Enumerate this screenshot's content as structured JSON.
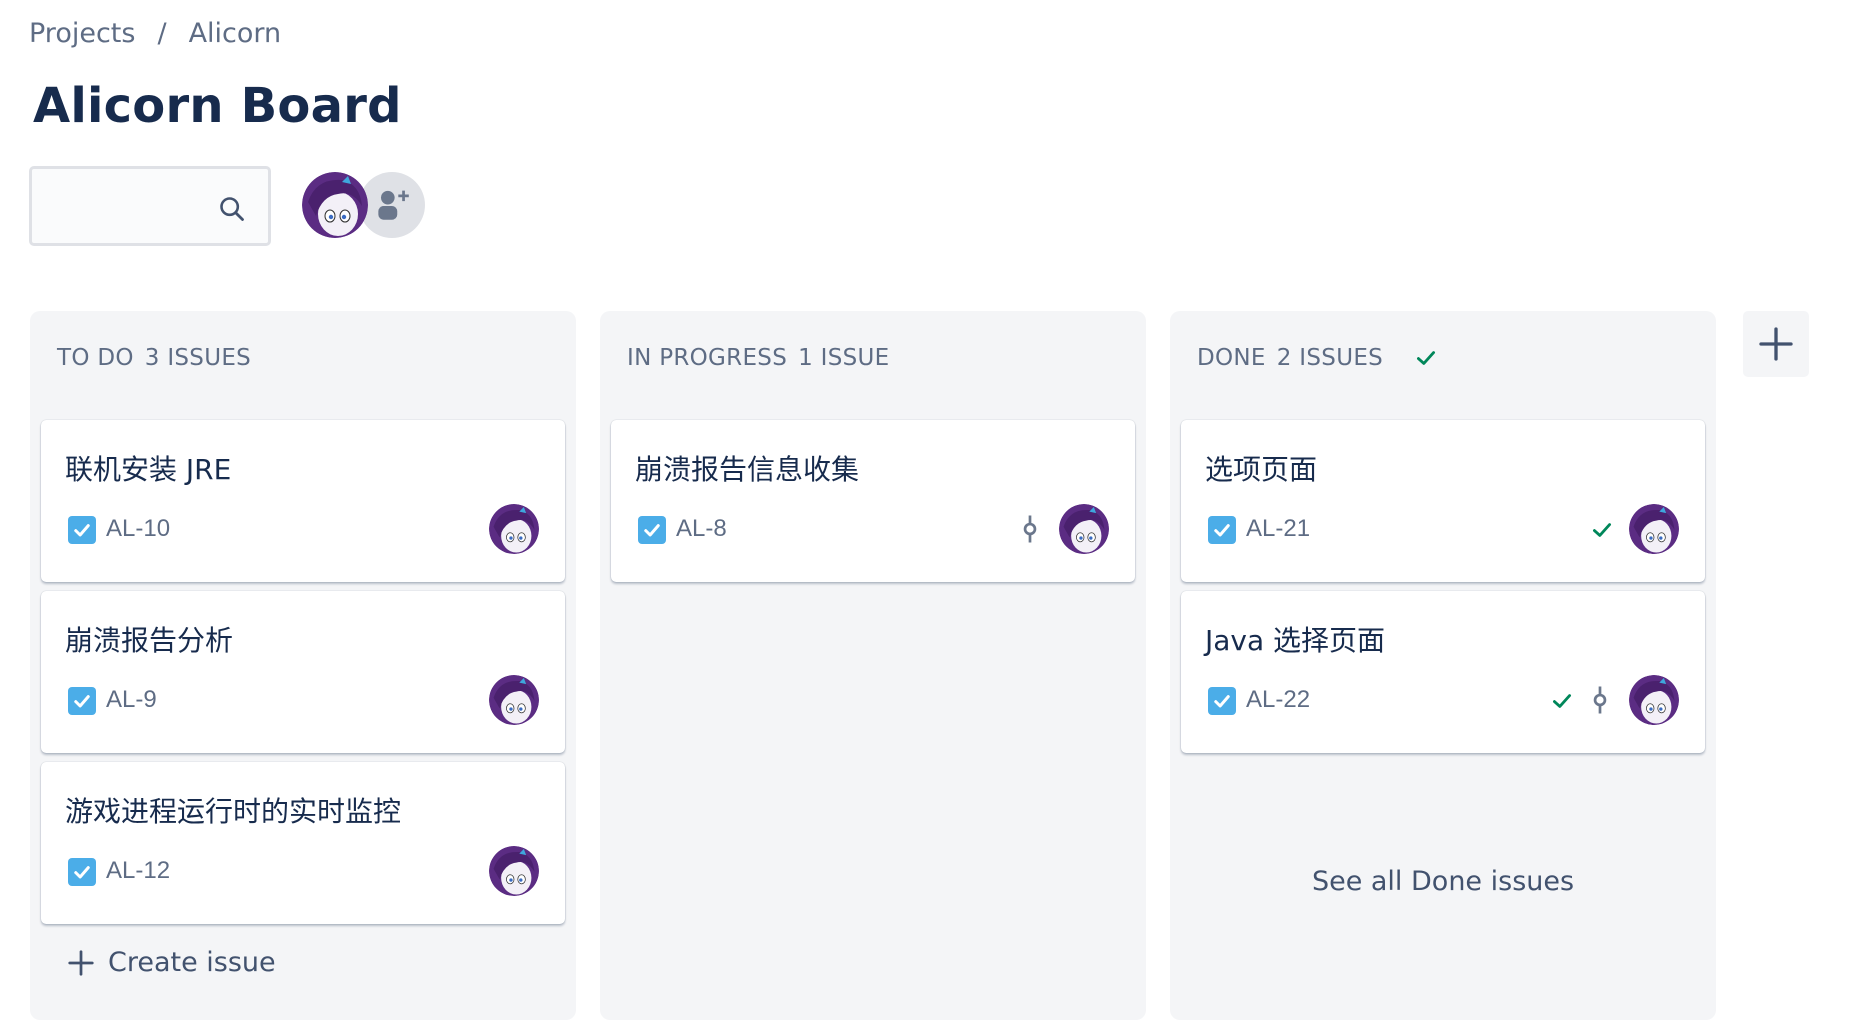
{
  "breadcrumb": {
    "projects": "Projects",
    "separator": "/",
    "project": "Alicorn"
  },
  "page_title": "Alicorn Board",
  "search": {
    "placeholder": "",
    "value": ""
  },
  "colors": {
    "accent_blue": "#4bade8",
    "done_green": "#00875a",
    "column_bg": "#f4f5f7",
    "avatar_purple": "#5b2c83"
  },
  "columns": [
    {
      "name": "TO DO",
      "count_label": "3 ISSUES",
      "cards": [
        {
          "summary": "联机安装 JRE",
          "key": "AL-10",
          "icon": "checkbox-story-icon"
        },
        {
          "summary": "崩溃报告分析",
          "key": "AL-9",
          "icon": "checkbox-story-icon"
        },
        {
          "summary": "游戏进程运行时的实时监控",
          "key": "AL-12",
          "icon": "checkbox-story-icon"
        }
      ],
      "footer": "Create issue"
    },
    {
      "name": "IN PROGRESS",
      "count_label": "1 ISSUE",
      "cards": [
        {
          "summary": "崩溃报告信息收集",
          "key": "AL-8",
          "icon": "checkbox-story-icon",
          "commit": true
        }
      ]
    },
    {
      "name": "DONE",
      "count_label": "2 ISSUES",
      "cards": [
        {
          "summary": "选项页面",
          "key": "AL-21",
          "icon": "checkbox-story-icon",
          "resolved": true
        },
        {
          "summary": "Java 选择页面",
          "key": "AL-22",
          "icon": "checkbox-story-icon",
          "resolved": true,
          "commit": true
        }
      ],
      "footer": "See all Done issues"
    }
  ]
}
